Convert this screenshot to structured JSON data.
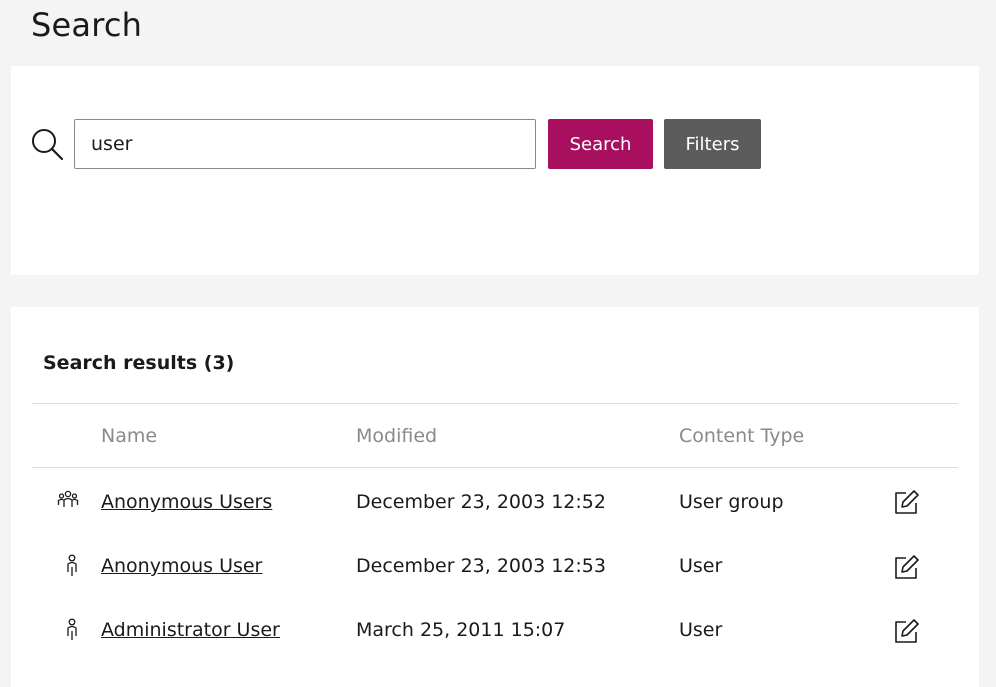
{
  "page": {
    "title": "Search"
  },
  "search": {
    "query": "user",
    "search_label": "Search",
    "filters_label": "Filters"
  },
  "results": {
    "heading": "Search results (3)",
    "columns": {
      "name": "Name",
      "modified": "Modified",
      "content_type": "Content Type"
    },
    "rows": [
      {
        "icon": "user-group-icon",
        "name": "Anonymous Users",
        "modified": "December 23, 2003 12:52",
        "content_type": "User group"
      },
      {
        "icon": "user-icon",
        "name": "Anonymous User",
        "modified": "December 23, 2003 12:53",
        "content_type": "User"
      },
      {
        "icon": "user-icon",
        "name": "Administrator User",
        "modified": "March 25, 2011 15:07",
        "content_type": "User"
      }
    ]
  },
  "colors": {
    "primary": "#a8105f",
    "secondary": "#5c5c5c",
    "background": "#f4f4f4"
  }
}
